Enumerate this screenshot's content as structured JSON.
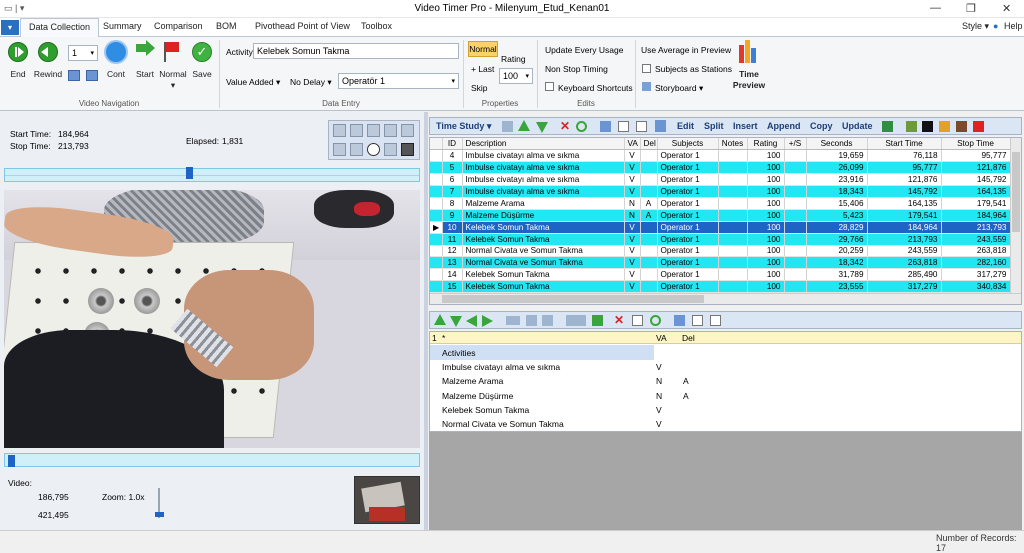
{
  "app": {
    "title": "Video Timer Pro - Milenyum_Etud_Kenan01",
    "style": "Style ▾",
    "help": "Help"
  },
  "tabs": [
    "Data Collection",
    "Summary",
    "Comparison",
    "BOM",
    "Pivothead Point of View",
    "Toolbox"
  ],
  "ribbon": {
    "nav": {
      "end": "End",
      "rewind": "Rewind",
      "spin_value": "1",
      "cont": "Cont",
      "start": "Start",
      "normal": "Normal",
      "save": "Save",
      "group": "Video Navigation"
    },
    "entry": {
      "activity_label": "Activity",
      "activity_value": "Kelebek Somun Takma",
      "value_added": "Value Added ▾",
      "no_delay": "No Delay ▾",
      "operator": "Operatör 1",
      "group": "Data Entry"
    },
    "props": {
      "normal": "Normal",
      "last": "+ Last",
      "skip": "Skip",
      "rating_label": "Rating",
      "rating_value": "100",
      "group": "Properties"
    },
    "edits": {
      "update_every": "Update Every Usage",
      "non_stop": "Non Stop Timing",
      "keyboard": "Keyboard Shortcuts",
      "group": "Edits"
    },
    "options": {
      "use_average": "Use Average in Preview",
      "subjects_stations": "Subjects as Stations",
      "storyboard": "Storyboard ▾",
      "time_preview": "Time Preview"
    }
  },
  "timing": {
    "start_label": "Start Time:",
    "start_value": "184,964",
    "stop_label": "Stop Time:",
    "stop_value": "213,793",
    "elapsed_label": "Elapsed:",
    "elapsed_value": "1,831"
  },
  "video": {
    "label": "Video:",
    "pos1": "186,795",
    "pos2": "421,495",
    "zoom": "Zoom: 1.0x",
    "slider_pos": 0.45,
    "scrub_pos": 0.02
  },
  "grid": {
    "toolbar": {
      "time_study": "Time Study ▾",
      "edit": "Edit",
      "split": "Split",
      "insert": "Insert",
      "append": "Append",
      "copy": "Copy",
      "update": "Update"
    },
    "columns": [
      "ID",
      "Description",
      "VA",
      "Del",
      "Subjects",
      "Notes",
      "Rating",
      "+/S",
      "Seconds",
      "Start Time",
      "Stop Time"
    ],
    "rows": [
      {
        "id": "4",
        "desc": "Imbulse civatayı alma ve sıkma",
        "va": "V",
        "del": "",
        "subj": "Operator 1",
        "rating": "100",
        "sec": "19,659",
        "start": "76,118",
        "stop": "95,777",
        "style": "white"
      },
      {
        "id": "5",
        "desc": "Imbulse civatayı alma ve sıkma",
        "va": "V",
        "del": "",
        "subj": "Operator 1",
        "rating": "100",
        "sec": "26,099",
        "start": "95,777",
        "stop": "121,876",
        "style": "cyan"
      },
      {
        "id": "6",
        "desc": "Imbulse civatayı alma ve sıkma",
        "va": "V",
        "del": "",
        "subj": "Operator 1",
        "rating": "100",
        "sec": "23,916",
        "start": "121,876",
        "stop": "145,792",
        "style": "white"
      },
      {
        "id": "7",
        "desc": "Imbulse civatayı alma ve sıkma",
        "va": "V",
        "del": "",
        "subj": "Operator 1",
        "rating": "100",
        "sec": "18,343",
        "start": "145,792",
        "stop": "164,135",
        "style": "cyan"
      },
      {
        "id": "8",
        "desc": "Malzeme Arama",
        "va": "N",
        "del": "A",
        "subj": "Operator 1",
        "rating": "100",
        "sec": "15,406",
        "start": "164,135",
        "stop": "179,541",
        "style": "white"
      },
      {
        "id": "9",
        "desc": "Malzeme Düşürme",
        "va": "N",
        "del": "A",
        "subj": "Operator 1",
        "rating": "100",
        "sec": "5,423",
        "start": "179,541",
        "stop": "184,964",
        "style": "cyan"
      },
      {
        "id": "10",
        "desc": "Kelebek Somun Takma",
        "va": "V",
        "del": "",
        "subj": "Operator 1",
        "rating": "100",
        "sec": "28,829",
        "start": "184,964",
        "stop": "213,793",
        "style": "sel"
      },
      {
        "id": "11",
        "desc": "Kelebek Somun Takma",
        "va": "V",
        "del": "",
        "subj": "Operator 1",
        "rating": "100",
        "sec": "29,766",
        "start": "213,793",
        "stop": "243,559",
        "style": "cyan"
      },
      {
        "id": "12",
        "desc": "Normal Civata ve Somun Takma",
        "va": "V",
        "del": "",
        "subj": "Operator 1",
        "rating": "100",
        "sec": "20,259",
        "start": "243,559",
        "stop": "263,818",
        "style": "white"
      },
      {
        "id": "13",
        "desc": "Normal Civata ve Somun Takma",
        "va": "V",
        "del": "",
        "subj": "Operator 1",
        "rating": "100",
        "sec": "18,342",
        "start": "263,818",
        "stop": "282,160",
        "style": "cyan"
      },
      {
        "id": "14",
        "desc": "Kelebek Somun Takma",
        "va": "V",
        "del": "",
        "subj": "Operator 1",
        "rating": "100",
        "sec": "31,789",
        "start": "285,490",
        "stop": "317,279",
        "style": "white"
      },
      {
        "id": "15",
        "desc": "Kelebek Somun Takma",
        "va": "V",
        "del": "",
        "subj": "Operator 1",
        "rating": "100",
        "sec": "23,555",
        "start": "317,279",
        "stop": "340,834",
        "style": "cyan"
      }
    ]
  },
  "activities": {
    "header1": "1",
    "header2": "*",
    "col_va": "VA",
    "col_del": "Del",
    "title": "Activities",
    "items": [
      {
        "name": "Imbulse civatayı alma ve sıkma",
        "va": "V",
        "del": ""
      },
      {
        "name": "Malzeme Arama",
        "va": "N",
        "del": "A"
      },
      {
        "name": "Malzeme Düşürme",
        "va": "N",
        "del": "A"
      },
      {
        "name": "Kelebek Somun Takma",
        "va": "V",
        "del": ""
      },
      {
        "name": "Normal Civata ve Somun Takma",
        "va": "V",
        "del": ""
      }
    ]
  },
  "status": {
    "records": "Number of Records: 17"
  },
  "colors": {
    "cyan": "#23e7f0",
    "selected": "#1d64c4",
    "accent": "#2b6fc0"
  }
}
